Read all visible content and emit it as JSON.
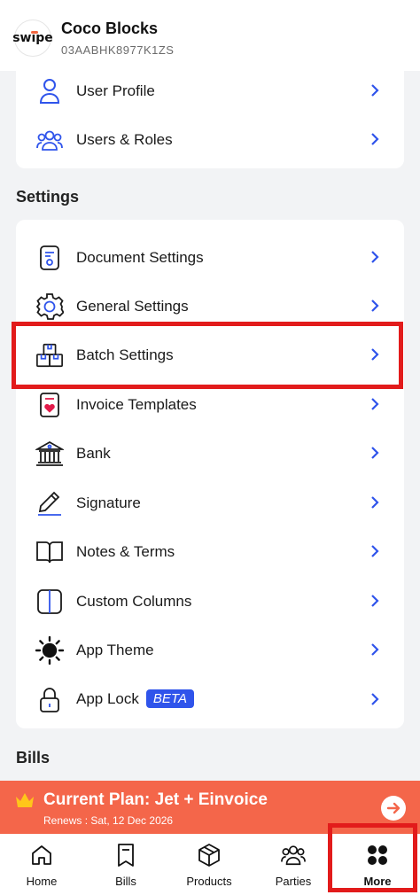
{
  "header": {
    "logo_text": "swipe",
    "company_name": "Coco Blocks",
    "gstin": "03AABHK8977K1ZS"
  },
  "account_items": [
    {
      "label": "User Profile",
      "icon": "user-icon"
    },
    {
      "label": "Users & Roles",
      "icon": "users-icon"
    }
  ],
  "settings": {
    "title": "Settings",
    "items": [
      {
        "label": "Document Settings",
        "icon": "document-settings-icon"
      },
      {
        "label": "General Settings",
        "icon": "gear-icon"
      },
      {
        "label": "Batch Settings",
        "icon": "boxes-icon"
      },
      {
        "label": "Invoice Templates",
        "icon": "invoice-template-icon"
      },
      {
        "label": "Bank",
        "icon": "bank-icon"
      },
      {
        "label": "Signature",
        "icon": "pen-icon"
      },
      {
        "label": "Notes & Terms",
        "icon": "book-icon"
      },
      {
        "label": "Custom Columns",
        "icon": "columns-icon"
      },
      {
        "label": "App Theme",
        "icon": "sun-icon"
      },
      {
        "label": "App Lock",
        "icon": "lock-icon",
        "badge": "BETA"
      }
    ]
  },
  "bills_section": {
    "title": "Bills"
  },
  "plan": {
    "title": "Current Plan: Jet + Einvoice",
    "renews": "Renews : Sat, 12 Dec 2026"
  },
  "nav": [
    {
      "label": "Home",
      "icon": "home-icon"
    },
    {
      "label": "Bills",
      "icon": "bookmark-icon"
    },
    {
      "label": "Products",
      "icon": "box-icon"
    },
    {
      "label": "Parties",
      "icon": "people-icon"
    },
    {
      "label": "More",
      "icon": "grid-icon",
      "active": true
    }
  ],
  "colors": {
    "accent": "#2f54eb",
    "plan_banner": "#f4664a",
    "highlight": "#e21b1b"
  }
}
